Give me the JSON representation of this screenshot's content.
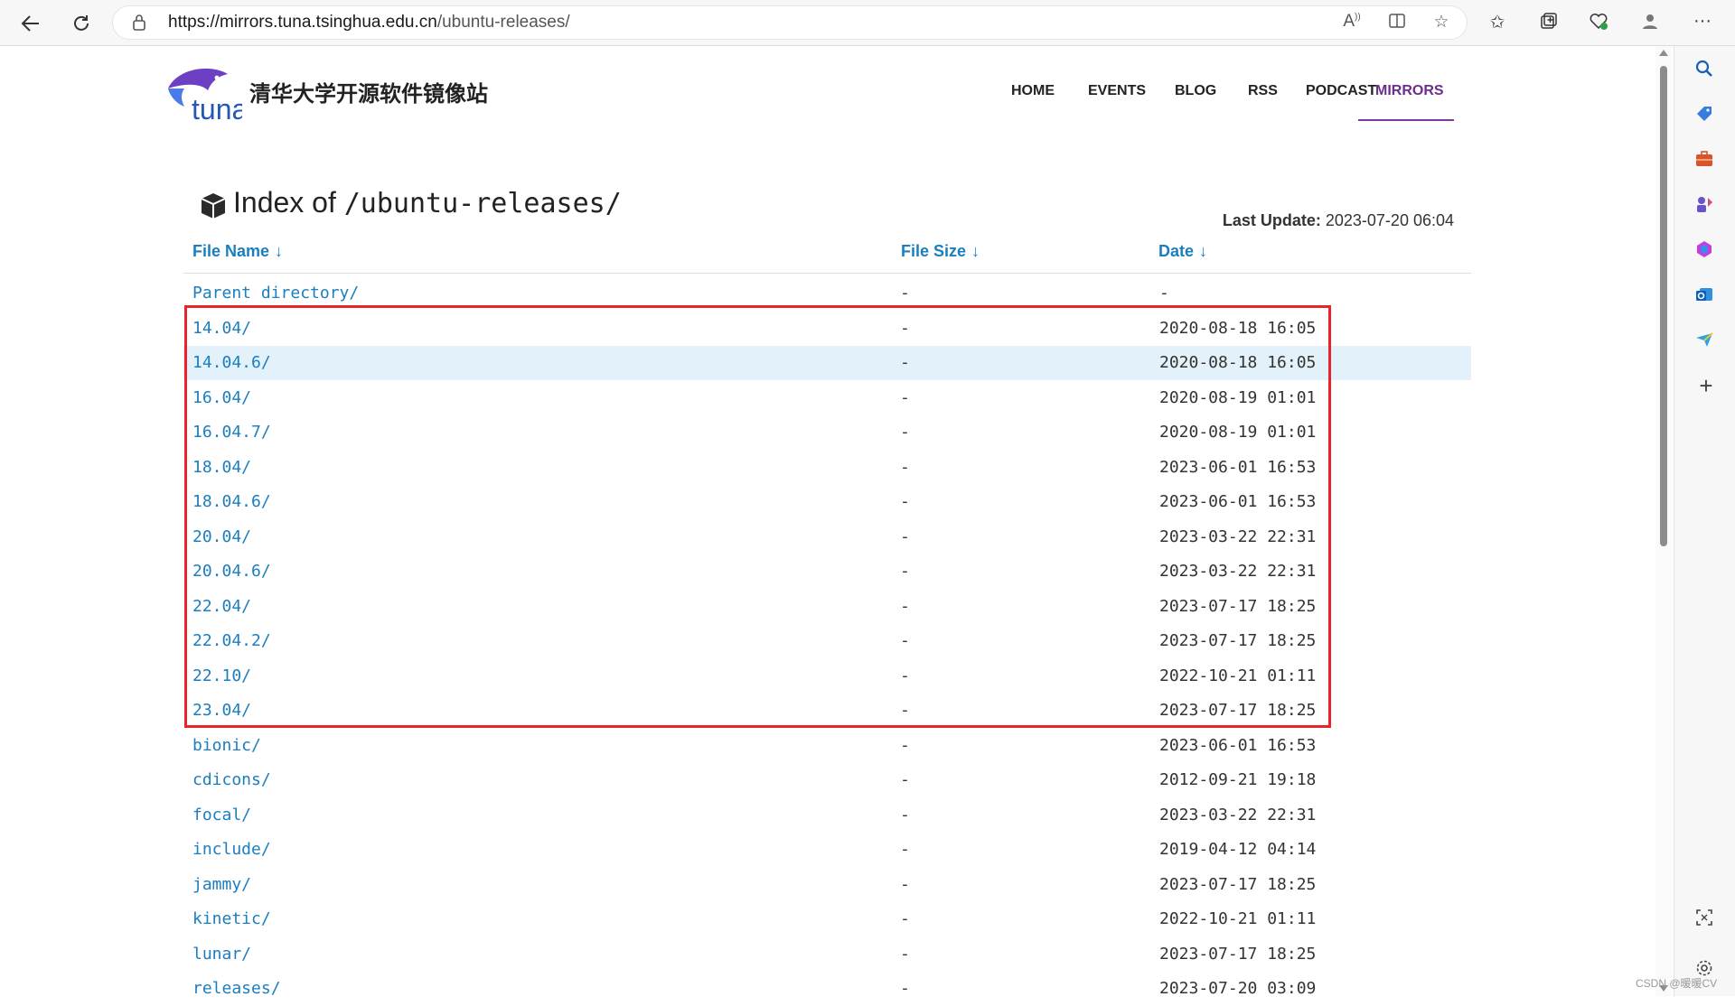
{
  "browser": {
    "url_prefix": "https://mirrors.tuna.tsinghua.edu.cn",
    "url_path": "/ubuntu-releases/"
  },
  "site": {
    "name": "清华大学开源软件镜像站",
    "logo_text": "tuna"
  },
  "nav": [
    "HOME",
    "EVENTS",
    "BLOG",
    "RSS",
    "PODCAST",
    "MIRRORS"
  ],
  "page": {
    "title_prefix": "Index of",
    "title_path": "/ubuntu-releases/",
    "last_update_label": "Last Update:",
    "last_update_value": "2023-07-20 06:04"
  },
  "table": {
    "headers": [
      "File Name",
      "File Size",
      "Date"
    ],
    "sort_arrow": "↓",
    "rows": [
      {
        "name": "Parent directory/",
        "size": "-",
        "date": "-"
      },
      {
        "name": "14.04/",
        "size": "-",
        "date": "2020-08-18 16:05"
      },
      {
        "name": "14.04.6/",
        "size": "-",
        "date": "2020-08-18 16:05"
      },
      {
        "name": "16.04/",
        "size": "-",
        "date": "2020-08-19 01:01"
      },
      {
        "name": "16.04.7/",
        "size": "-",
        "date": "2020-08-19 01:01"
      },
      {
        "name": "18.04/",
        "size": "-",
        "date": "2023-06-01 16:53"
      },
      {
        "name": "18.04.6/",
        "size": "-",
        "date": "2023-06-01 16:53"
      },
      {
        "name": "20.04/",
        "size": "-",
        "date": "2023-03-22 22:31"
      },
      {
        "name": "20.04.6/",
        "size": "-",
        "date": "2023-03-22 22:31"
      },
      {
        "name": "22.04/",
        "size": "-",
        "date": "2023-07-17 18:25"
      },
      {
        "name": "22.04.2/",
        "size": "-",
        "date": "2023-07-17 18:25"
      },
      {
        "name": "22.10/",
        "size": "-",
        "date": "2022-10-21 01:11"
      },
      {
        "name": "23.04/",
        "size": "-",
        "date": "2023-07-17 18:25"
      },
      {
        "name": "bionic/",
        "size": "-",
        "date": "2023-06-01 16:53"
      },
      {
        "name": "cdicons/",
        "size": "-",
        "date": "2012-09-21 19:18"
      },
      {
        "name": "focal/",
        "size": "-",
        "date": "2023-03-22 22:31"
      },
      {
        "name": "include/",
        "size": "-",
        "date": "2019-04-12 04:14"
      },
      {
        "name": "jammy/",
        "size": "-",
        "date": "2023-07-17 18:25"
      },
      {
        "name": "kinetic/",
        "size": "-",
        "date": "2022-10-21 01:11"
      },
      {
        "name": "lunar/",
        "size": "-",
        "date": "2023-07-17 18:25"
      },
      {
        "name": "releases/",
        "size": "-",
        "date": "2023-07-20 03:09"
      }
    ]
  },
  "watermark": "CSDN @暖暖CV",
  "colors": {
    "link": "#1a7ebf",
    "active_nav": "#6c2d8c",
    "highlight_row": "#e2f1fa",
    "annotation_box": "#e8232a"
  }
}
